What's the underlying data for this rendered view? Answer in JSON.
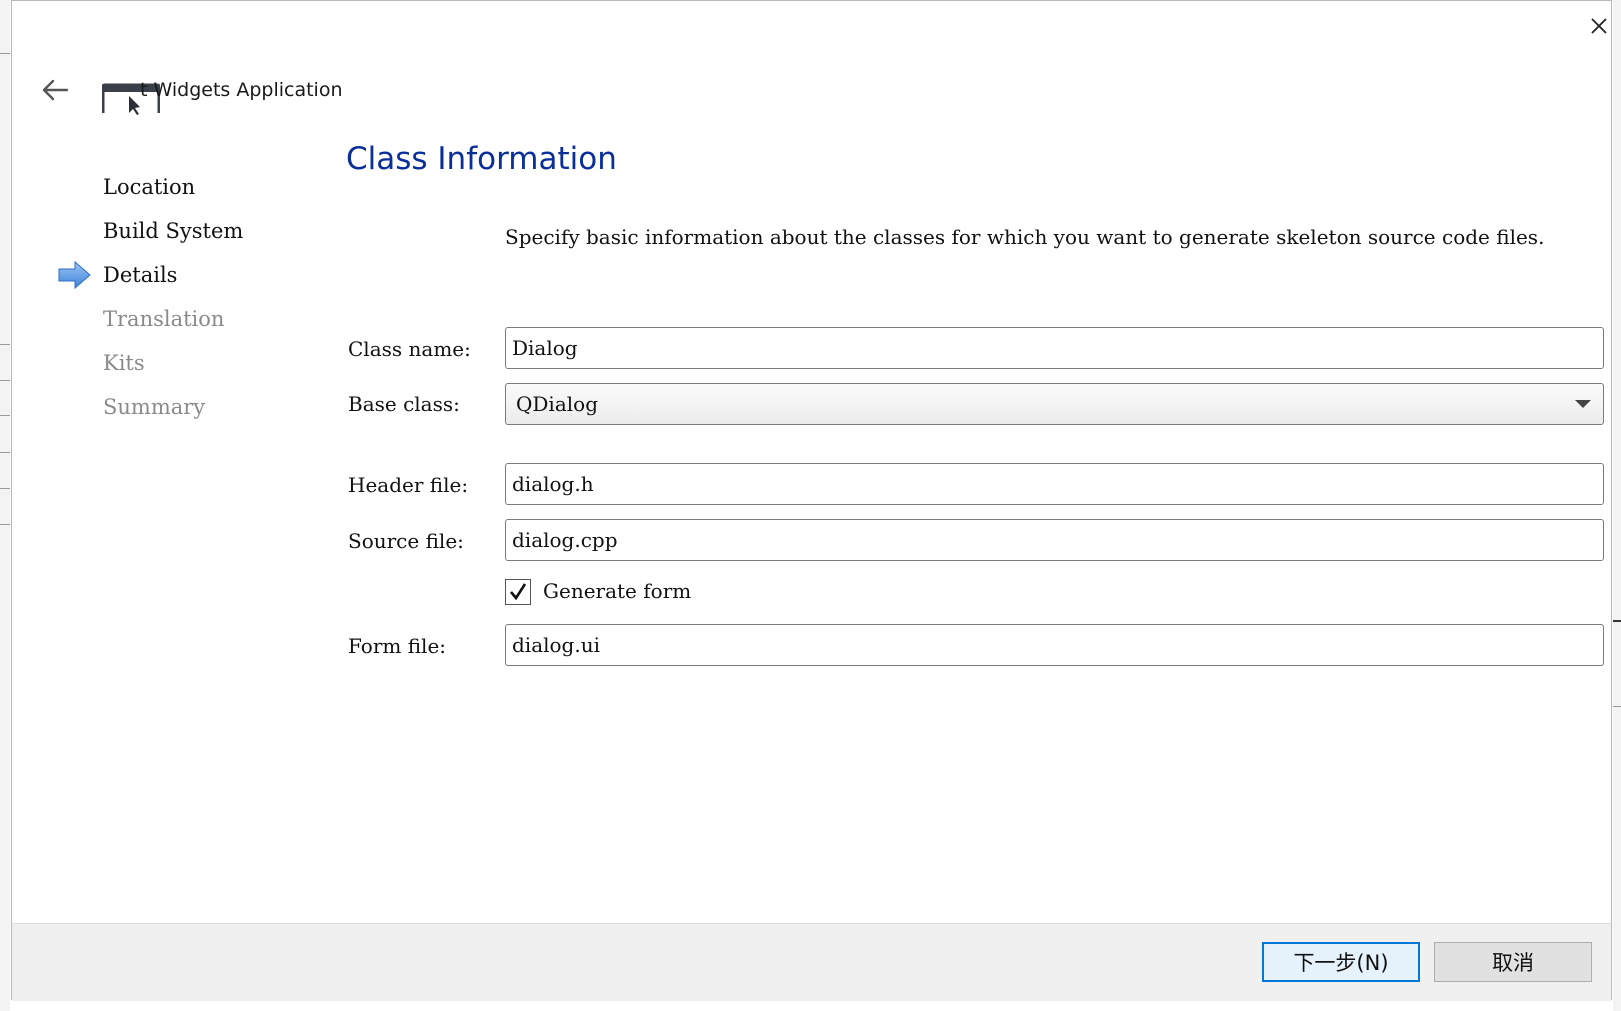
{
  "header": {
    "app_title": "t Widgets Application"
  },
  "sidebar": {
    "items": [
      {
        "label": "Location",
        "state": "done"
      },
      {
        "label": "Build System",
        "state": "done"
      },
      {
        "label": "Details",
        "state": "current"
      },
      {
        "label": "Translation",
        "state": "disabled"
      },
      {
        "label": "Kits",
        "state": "disabled"
      },
      {
        "label": "Summary",
        "state": "disabled"
      }
    ]
  },
  "main": {
    "title": "Class Information",
    "description": "Specify basic information about the classes for which you want to generate skeleton source code files.",
    "class_name": {
      "label": "Class name:",
      "value": "Dialog"
    },
    "base_class": {
      "label": "Base class:",
      "value": "QDialog"
    },
    "header_file": {
      "label": "Header file:",
      "value": "dialog.h"
    },
    "source_file": {
      "label": "Source file:",
      "value": "dialog.cpp"
    },
    "generate_form": {
      "label": "Generate form",
      "checked": true
    },
    "form_file": {
      "label": "Form file:",
      "value": "dialog.ui"
    }
  },
  "footer": {
    "next_label": "下一步(N)",
    "cancel_label": "取消"
  },
  "colors": {
    "title": "#0a2f99",
    "nav_arrow": "#4a90e2",
    "default_button_border": "#0078d7"
  },
  "icons": {
    "back": "back-arrow-icon",
    "close": "close-icon",
    "current_step": "step-arrow-icon",
    "app": "application-window-icon",
    "check": "checkmark-icon",
    "dropdown": "chevron-down-icon"
  }
}
